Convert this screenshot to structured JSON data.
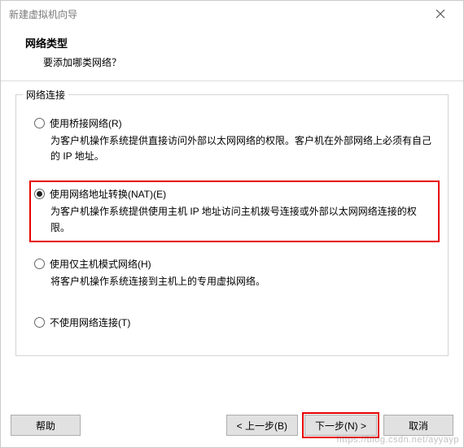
{
  "window": {
    "title": "新建虚拟机向导"
  },
  "header": {
    "title": "网络类型",
    "subtitle": "要添加哪类网络？"
  },
  "fieldset": {
    "legend": "网络连接"
  },
  "options": {
    "bridged": {
      "label": "使用桥接网络(R)",
      "desc": "为客户机操作系统提供直接访问外部以太网网络的权限。客户机在外部网络上必须有自己的 IP 地址。"
    },
    "nat": {
      "label": "使用网络地址转换(NAT)(E)",
      "desc": "为客户机操作系统提供使用主机 IP 地址访问主机拨号连接或外部以太网网络连接的权限。"
    },
    "hostonly": {
      "label": "使用仅主机模式网络(H)",
      "desc": "将客户机操作系统连接到主机上的专用虚拟网络。"
    },
    "none": {
      "label": "不使用网络连接(T)"
    }
  },
  "buttons": {
    "help": "帮助",
    "back": "< 上一步(B)",
    "next": "下一步(N) >",
    "cancel": "取消"
  },
  "watermark": "https://blog.csdn.net/ayyayp"
}
